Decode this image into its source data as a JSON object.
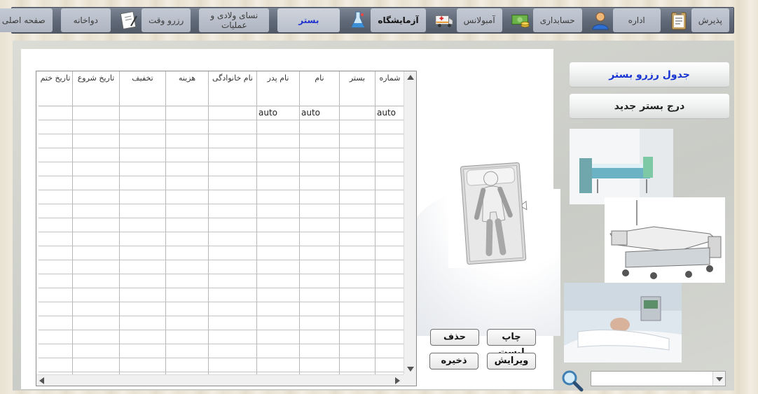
{
  "nav": {
    "items": [
      {
        "label": "پذیرش",
        "icon": "clipboard-icon"
      },
      {
        "label": "اداره",
        "icon": "user-avatar-icon"
      },
      {
        "label": "حسابداری",
        "icon": "money-icon"
      },
      {
        "label": "آمبولانس",
        "icon": "ambulance-icon"
      },
      {
        "label": "آزمایشگاه",
        "icon": "flask-icon"
      },
      {
        "label": "بستر",
        "icon": ""
      },
      {
        "label": "نسای ولادی و عملیات",
        "icon": ""
      },
      {
        "label": "رزرو وقت",
        "icon": "notepad-icon"
      },
      {
        "label": "دواخانه",
        "icon": ""
      },
      {
        "label": "صفحه اصلی",
        "icon": "home-icon"
      }
    ]
  },
  "table": {
    "columns": [
      "شماره",
      "بستر",
      "نام",
      "نام پدر",
      "نام خانوادگی",
      "هزینه",
      "تخفیف",
      "تاریخ شروع",
      "تاریخ ختم"
    ],
    "first_row": [
      "auto",
      "",
      "auto",
      "auto",
      "",
      "",
      "",
      "",
      ""
    ]
  },
  "buttons": {
    "print_list": "چاپ لیست",
    "delete": "حذف",
    "edit": "ویرایش",
    "save": "ذخیره"
  },
  "right": {
    "bed_reservation_table": "جدول رزرو بستر",
    "add_new_bed": "درج بستر جدید"
  },
  "search": {
    "value": ""
  },
  "colors": {
    "nav_active": "#1e2fd0",
    "link_blue": "#1733d1"
  }
}
